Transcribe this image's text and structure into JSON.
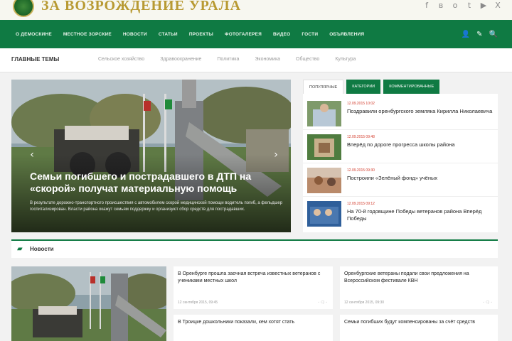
{
  "header": {
    "logo_text": "ЗА ВОЗРОЖДЕНИЕ УРАЛА",
    "socials": [
      {
        "name": "facebook-icon",
        "glyph": "f"
      },
      {
        "name": "vk-icon",
        "glyph": "в"
      },
      {
        "name": "ok-icon",
        "glyph": "о"
      },
      {
        "name": "twitter-icon",
        "glyph": "t"
      },
      {
        "name": "youtube-icon",
        "glyph": "▶"
      },
      {
        "name": "x-icon",
        "glyph": "X"
      }
    ]
  },
  "nav": {
    "items": [
      "О ДЕМОСКИНЕ",
      "МЕСТНОЕ ЗОРСКИЕ",
      "НОВОСТИ",
      "СТАТЬИ",
      "ПРОЕКТЫ",
      "ФОТОГАЛЕРЕЯ",
      "ВИДЕО",
      "ГОСТИ",
      "ОБЪЯВЛЕНИЯ"
    ],
    "tools": {
      "user": "👤",
      "edit": "✎",
      "search": "🔍"
    }
  },
  "topics": {
    "title": "ГЛАВНЫЕ ТЕМЫ",
    "items": [
      "Сельское хозяйство",
      "Здравоохранение",
      "Политика",
      "Экономика",
      "Общество",
      "Культура"
    ]
  },
  "hero": {
    "title": "Семьи погибшего и пострадавшего в ДТП на «скорой» получат материальную помощь",
    "excerpt": "В результате дорожно-транспортного происшествия с автомобилем скорой медицинской помощи водитель погиб, а фельдшер госпитализирован. Власти района окажут семьям поддержку и организуют сбор средств для пострадавших.",
    "prev": "‹",
    "next": "›"
  },
  "sidebar": {
    "tabs": [
      "ПОПУЛЯРНЫЕ",
      "КАТЕГОРИИ",
      "КОММЕНТИРОВАННЫЕ"
    ],
    "items": [
      {
        "date": "12.09.2015 10:02",
        "title": "Поздравили оренбургского земляка Кирилла Николаевича"
      },
      {
        "date": "12.09.2015 09:48",
        "title": "Вперёд по дороге прогресса школы района"
      },
      {
        "date": "12.09.2015 09:30",
        "title": "Построили «Зелёный фонд» учёных"
      },
      {
        "date": "12.09.2015 09:12",
        "title": "На 70-й годовщине Победы ветеранов района Вперёд Победы"
      }
    ]
  },
  "news": {
    "title": "Новости",
    "cards": [
      {
        "title": "В Оренбурге прошла заочная встреча известных ветеранов с учениками местных школ",
        "meta": "12 сентября 2015, 09:45",
        "tools": "◦ 🗨 ◦"
      },
      {
        "title": "Оренбургские ветераны подали свои предложения на Всероссийском фестивале КВН",
        "meta": "12 сентября 2015, 09:30",
        "tools": "◦ 🗨 ◦"
      },
      {
        "title": "В Троицке дошкольники показали, кем хотят стать",
        "meta": "",
        "tools": ""
      },
      {
        "title": "Семьи погибших будут компенсированы за счёт средств",
        "meta": "",
        "tools": ""
      }
    ]
  }
}
